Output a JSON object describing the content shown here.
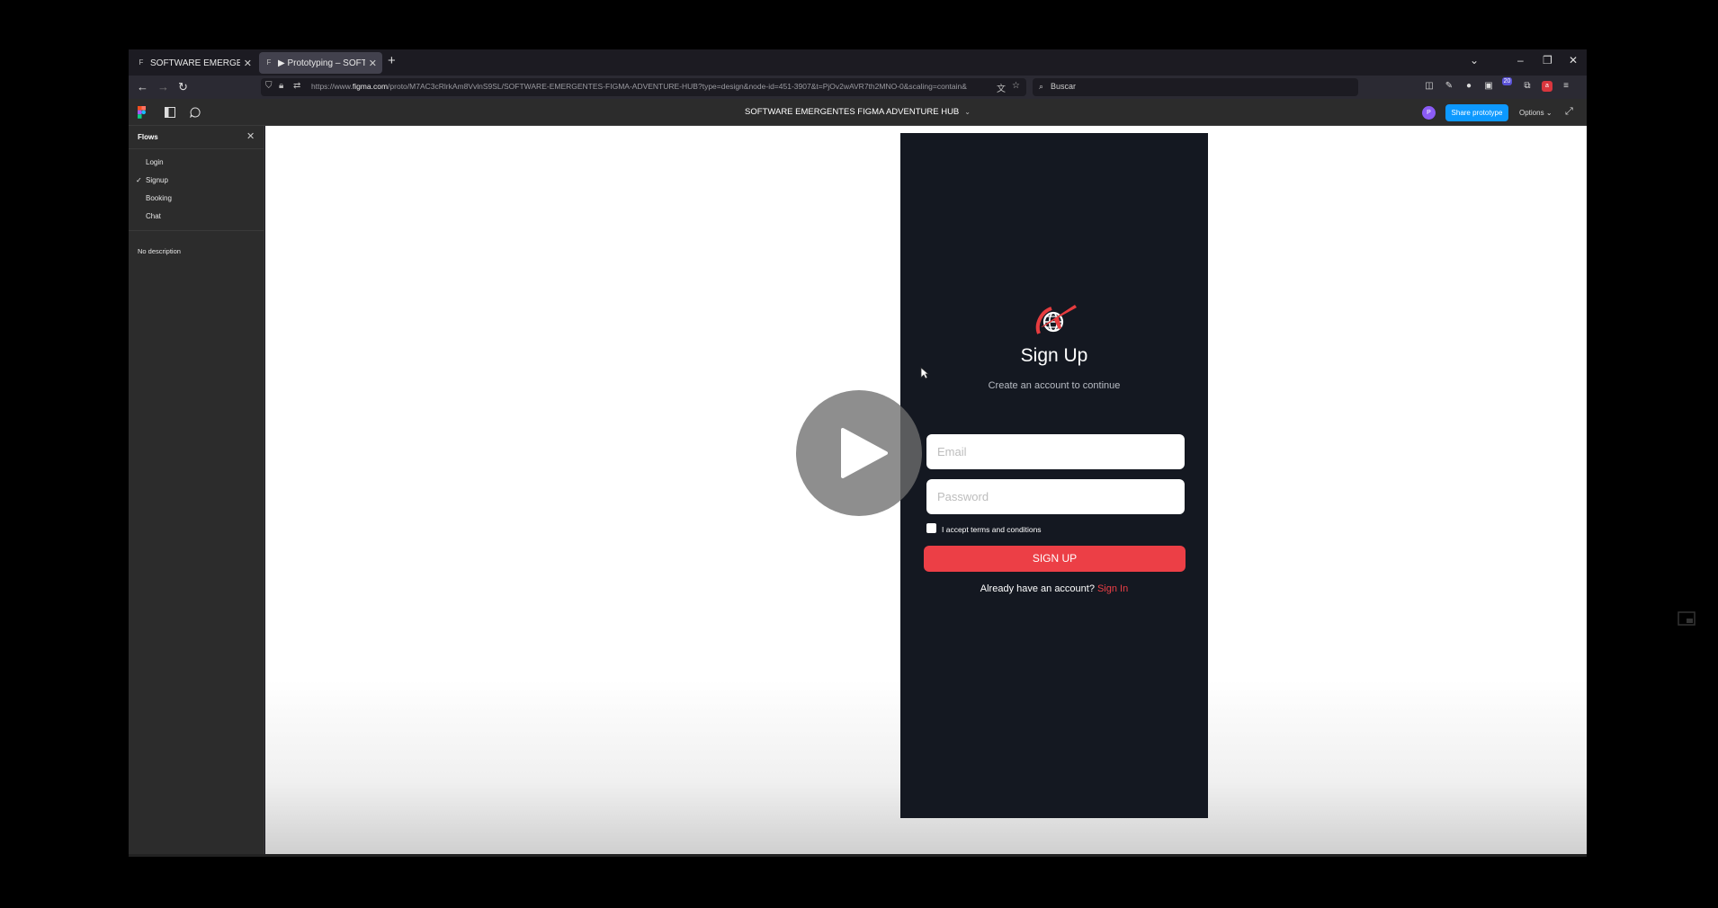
{
  "browser": {
    "tabs": [
      {
        "title": "SOFTWARE EMERGENTES FIGM",
        "active": false
      },
      {
        "title": "▶ Prototyping – SOFTWARE EM",
        "active": true
      }
    ],
    "url_prefix": "https://www.",
    "url_domain": "figma.com",
    "url_rest": "/proto/M7AC3cRlrkAm8VvlnS9SL/SOFTWARE-EMERGENTES-FIGMA-ADVENTURE-HUB?type=design&node-id=451-3907&t=PjOv2wAVR7th2MNO-0&scaling=contain&",
    "search_placeholder": "Buscar",
    "extension_badge": "20"
  },
  "figma": {
    "file_title": "SOFTWARE EMERGENTES FIGMA ADVENTURE HUB",
    "avatar_initial": "P",
    "share_label": "Share prototype",
    "options_label": "Options"
  },
  "flows_panel": {
    "heading": "Flows",
    "items": [
      {
        "label": "Login",
        "selected": false
      },
      {
        "label": "Signup",
        "selected": true
      },
      {
        "label": "Booking",
        "selected": false
      },
      {
        "label": "Chat",
        "selected": false
      }
    ],
    "description": "No description"
  },
  "signup_screen": {
    "title": "Sign Up",
    "subtitle": "Create an account to continue",
    "email_placeholder": "Email",
    "password_placeholder": "Password",
    "terms_label": "I accept terms and conditions",
    "button_label": "SIGN UP",
    "already_text": "Already have an account?",
    "signin_link": "Sign In"
  },
  "colors": {
    "accent_red": "#ec3f46",
    "share_blue": "#0d99ff",
    "phone_bg": "#141821"
  }
}
